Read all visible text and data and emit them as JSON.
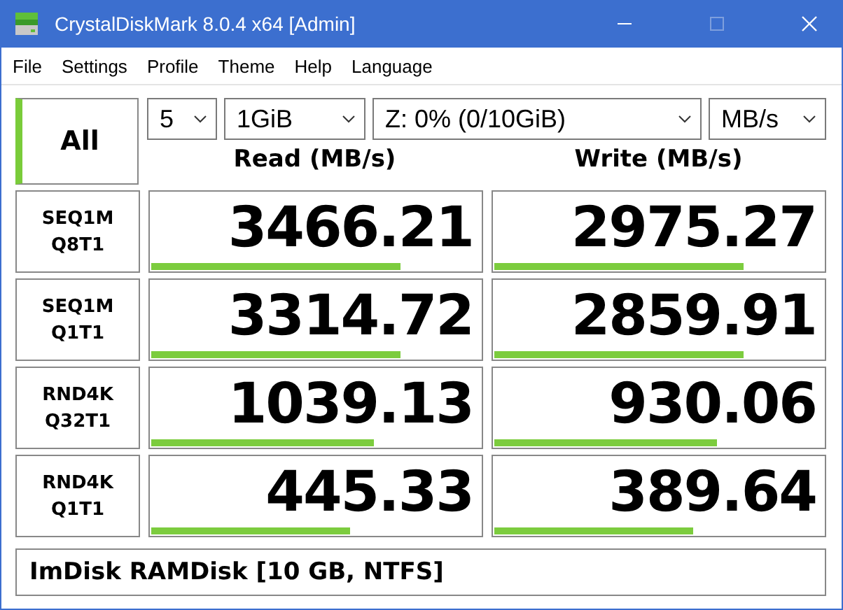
{
  "window": {
    "title": "CrystalDiskMark 8.0.4 x64 [Admin]",
    "maximize_disabled": true
  },
  "menu": [
    "File",
    "Settings",
    "Profile",
    "Theme",
    "Help",
    "Language"
  ],
  "all_button": "All",
  "dropdowns": [
    {
      "kind": "count",
      "value": "5"
    },
    {
      "kind": "size",
      "value": "1GiB"
    },
    {
      "kind": "drive",
      "value": "Z: 0% (0/10GiB)"
    },
    {
      "kind": "unit",
      "value": "MB/s"
    }
  ],
  "columns": [
    "Read (MB/s)",
    "Write (MB/s)"
  ],
  "rows": [
    {
      "test": [
        "SEQ1M",
        "Q8T1"
      ],
      "read": {
        "value": "3466.21",
        "level": 0.75
      },
      "write": {
        "value": "2975.27",
        "level": 0.75
      }
    },
    {
      "test": [
        "SEQ1M",
        "Q1T1"
      ],
      "read": {
        "value": "3314.72",
        "level": 0.75
      },
      "write": {
        "value": "2859.91",
        "level": 0.75
      }
    },
    {
      "test": [
        "RND4K",
        "Q32T1"
      ],
      "read": {
        "value": "1039.13",
        "level": 0.67
      },
      "write": {
        "value": "930.06",
        "level": 0.67
      }
    },
    {
      "test": [
        "RND4K",
        "Q1T1"
      ],
      "read": {
        "value": "445.33",
        "level": 0.6
      },
      "write": {
        "value": "389.64",
        "level": 0.6
      }
    }
  ],
  "comment": "ImDisk RAMDisk [10 GB, NTFS]"
}
